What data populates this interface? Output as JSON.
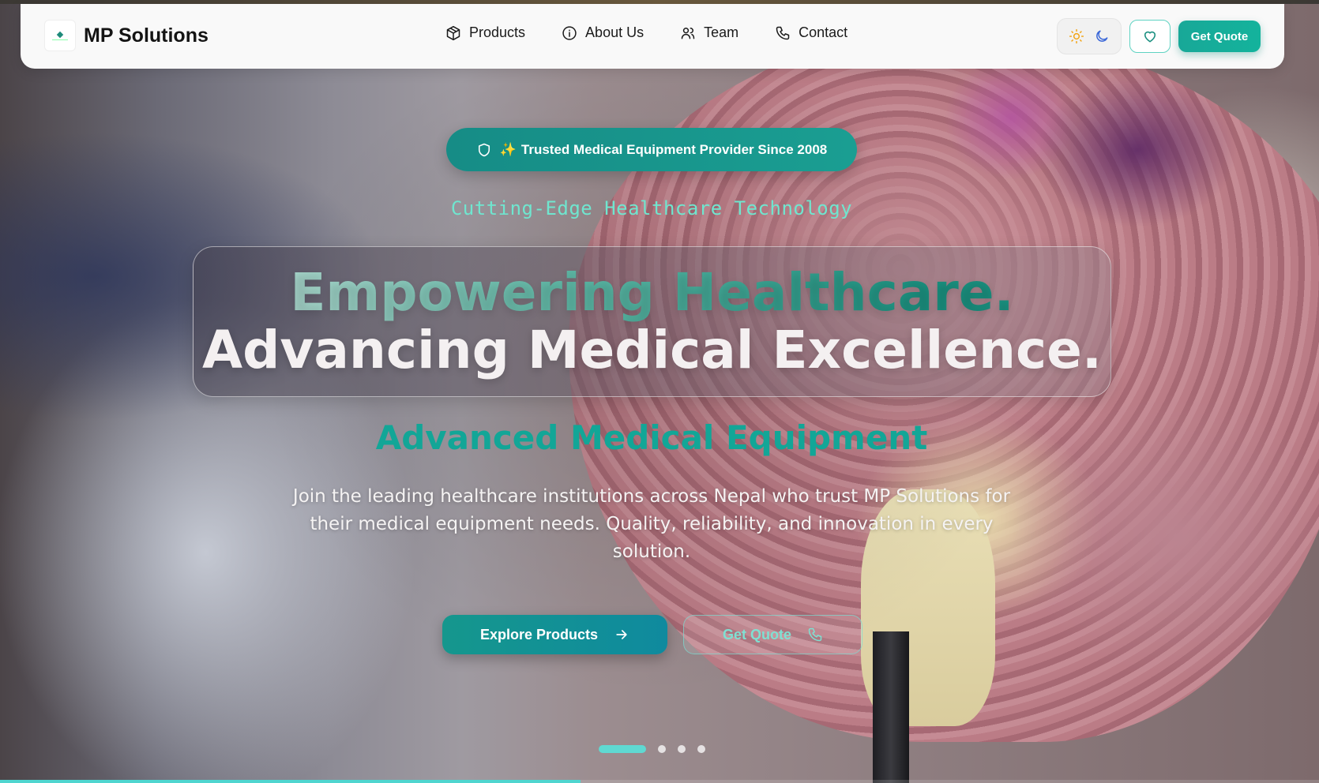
{
  "brand": {
    "name": "MP Solutions"
  },
  "nav": {
    "items": [
      {
        "label": "Products",
        "icon": "package-icon"
      },
      {
        "label": "About Us",
        "icon": "info-icon"
      },
      {
        "label": "Team",
        "icon": "users-icon"
      },
      {
        "label": "Contact",
        "icon": "phone-icon"
      }
    ],
    "theme_icons": [
      "sun-icon",
      "moon-icon"
    ],
    "favorite_icon": "heart-icon",
    "cta_label": "Get Quote"
  },
  "hero": {
    "badge_emoji": "✨",
    "badge_text": "Trusted Medical Equipment Provider Since 2008",
    "subtitle": "Cutting-Edge Healthcare Technology",
    "headline_line1": "Empowering Healthcare.",
    "headline_line2": "Advancing Medical Excellence.",
    "tagline": "Advanced Medical Equipment",
    "description": "Join the leading healthcare institutions across Nepal who trust MP Solutions for their medical equipment needs. Quality, reliability, and innovation in every solution.",
    "primary_button": "Explore Products",
    "secondary_button": "Get Quote"
  },
  "carousel": {
    "slide_count": 4,
    "active_index": 0,
    "progress": 0.44
  },
  "colors": {
    "accent": "#14b39c",
    "accent_dark": "#168c86",
    "subtitle": "#6fe6cf",
    "tagline": "#12a697"
  }
}
